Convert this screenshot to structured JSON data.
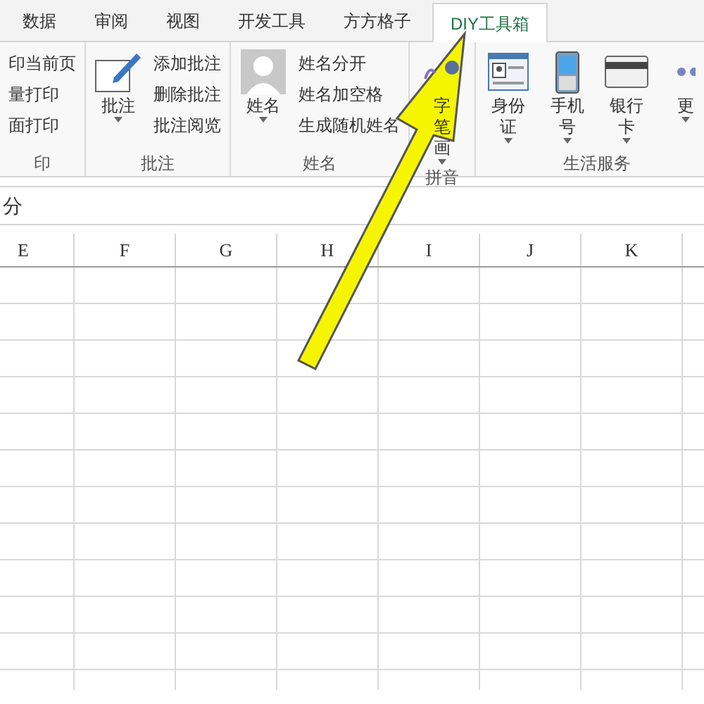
{
  "tabs": [
    {
      "label": "数据",
      "selected": false
    },
    {
      "label": "审阅",
      "selected": false
    },
    {
      "label": "视图",
      "selected": false
    },
    {
      "label": "开发工具",
      "selected": false
    },
    {
      "label": "方方格子",
      "selected": false
    },
    {
      "label": "DIY工具箱",
      "selected": true
    }
  ],
  "groups": [
    {
      "label": "印",
      "items": [
        {
          "kind": "small",
          "label": "印当前页"
        },
        {
          "kind": "small",
          "label": "量打印"
        },
        {
          "kind": "small",
          "label": "面打印"
        }
      ]
    },
    {
      "label": "批注",
      "items": [
        {
          "kind": "note",
          "lines": [
            "批注"
          ]
        },
        {
          "kind": "small",
          "label": "添加批注"
        },
        {
          "kind": "small",
          "label": "删除批注"
        },
        {
          "kind": "small",
          "label": "批注阅览"
        }
      ]
    },
    {
      "label": "姓名",
      "items": [
        {
          "kind": "person",
          "lines": [
            "姓名"
          ]
        },
        {
          "kind": "small",
          "label": "姓名分开"
        },
        {
          "kind": "small",
          "label": "姓名加空格"
        },
        {
          "kind": "small",
          "label": "生成随机姓名"
        }
      ]
    },
    {
      "label": "拼音",
      "items": [
        {
          "kind": "pinyin",
          "lines": [
            "字",
            "笔",
            "画"
          ]
        }
      ]
    },
    {
      "label": "生活服务",
      "items": [
        {
          "kind": "idcard",
          "lines": [
            "身份",
            "证"
          ]
        },
        {
          "kind": "phone",
          "lines": [
            "手机",
            "号"
          ]
        },
        {
          "kind": "card",
          "lines": [
            "银行",
            "卡"
          ]
        },
        {
          "kind": "more",
          "lines": [
            "更"
          ]
        }
      ]
    }
  ],
  "formula_bar": {
    "value": "分"
  },
  "columns": [
    "E",
    "F",
    "G",
    "H",
    "I",
    "J",
    "K"
  ]
}
